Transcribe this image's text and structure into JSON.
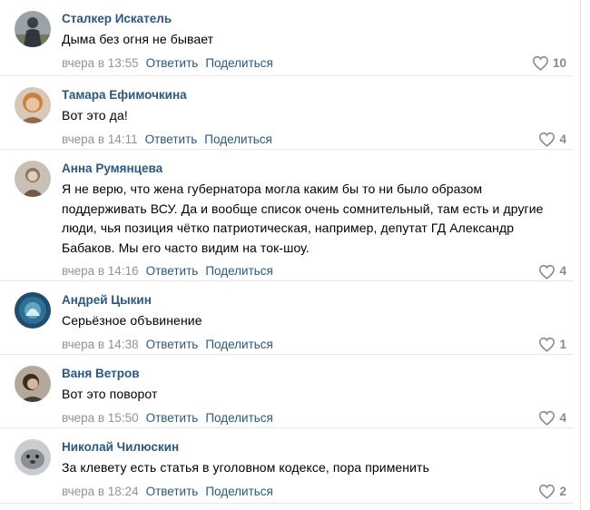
{
  "comments": [
    {
      "author": "Сталкер Искатель",
      "text": "Дыма без огня не бывает",
      "time": "вчера в 13:55",
      "reply": "Ответить",
      "share": "Поделиться",
      "likes": "10"
    },
    {
      "author": "Тамара Ефимочкина",
      "text": "Вот это да!",
      "time": "вчера в 14:11",
      "reply": "Ответить",
      "share": "Поделиться",
      "likes": "4"
    },
    {
      "author": "Анна Румянцева",
      "text": "Я не верю, что жена губернатора могла каким бы то ни было образом поддерживать ВСУ. Да и вообще список очень сомнительный, там есть и другие люди, чья позиция чётко патриотическая, например, депутат ГД Александр Бабаков. Мы его часто видим на ток-шоу.",
      "time": "вчера в 14:16",
      "reply": "Ответить",
      "share": "Поделиться",
      "likes": "4"
    },
    {
      "author": "Андрей Цыкин",
      "text": "Серьёзное объвинение",
      "time": "вчера в 14:38",
      "reply": "Ответить",
      "share": "Поделиться",
      "likes": "1"
    },
    {
      "author": "Ваня Ветров",
      "text": "Вот это поворот",
      "time": "вчера в 15:50",
      "reply": "Ответить",
      "share": "Поделиться",
      "likes": "4"
    },
    {
      "author": "Николай Чилюскин",
      "text": "За клевету есть статья в уголовном кодексе, пора применить",
      "time": "вчера в 18:24",
      "reply": "Ответить",
      "share": "Поделиться",
      "likes": "2"
    }
  ]
}
